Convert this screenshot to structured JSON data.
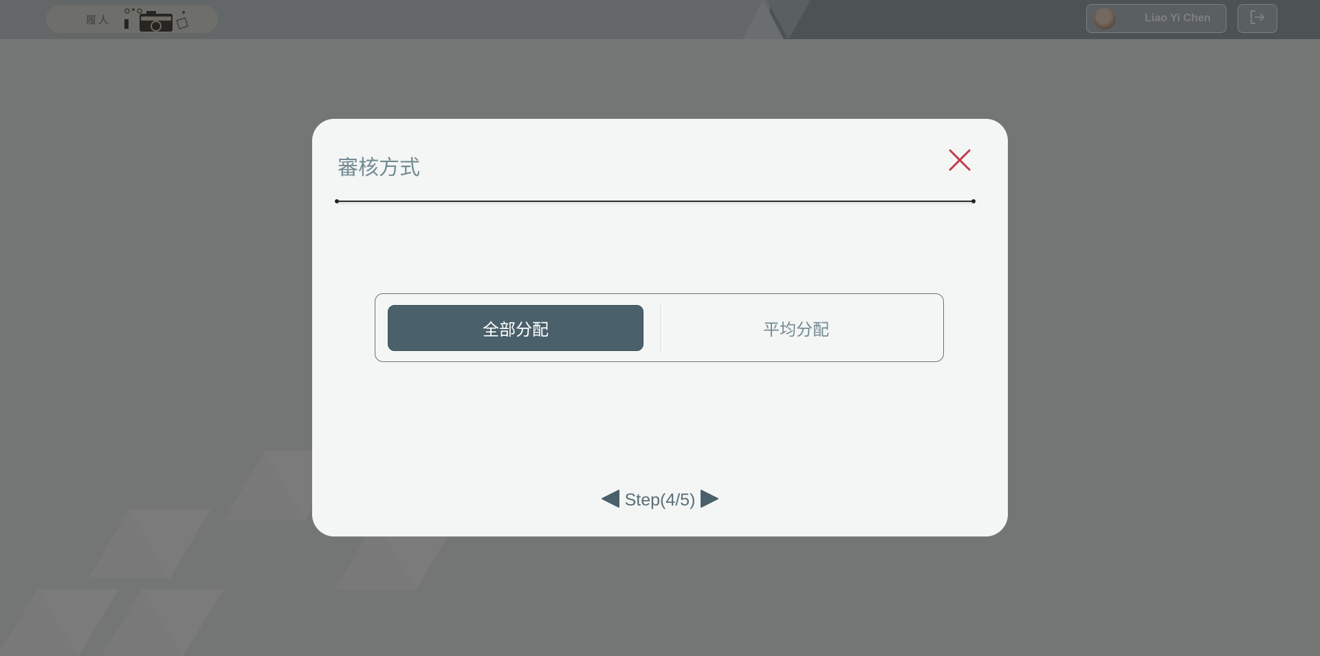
{
  "header": {
    "logo_text": "履人",
    "user_name": "Liao Yi Chen"
  },
  "modal": {
    "title": "審核方式",
    "options": [
      {
        "label": "全部分配",
        "selected": true
      },
      {
        "label": "平均分配",
        "selected": false
      }
    ],
    "step_text": "Step(4/5)"
  },
  "colors": {
    "accent": "#4a606a",
    "close": "#c33a4a",
    "title": "#738b93",
    "modal_bg": "#f4f6f5"
  },
  "icons": {
    "close": "close-icon",
    "prev": "triangle-left-icon",
    "next": "triangle-right-icon",
    "logout": "logout-icon"
  }
}
